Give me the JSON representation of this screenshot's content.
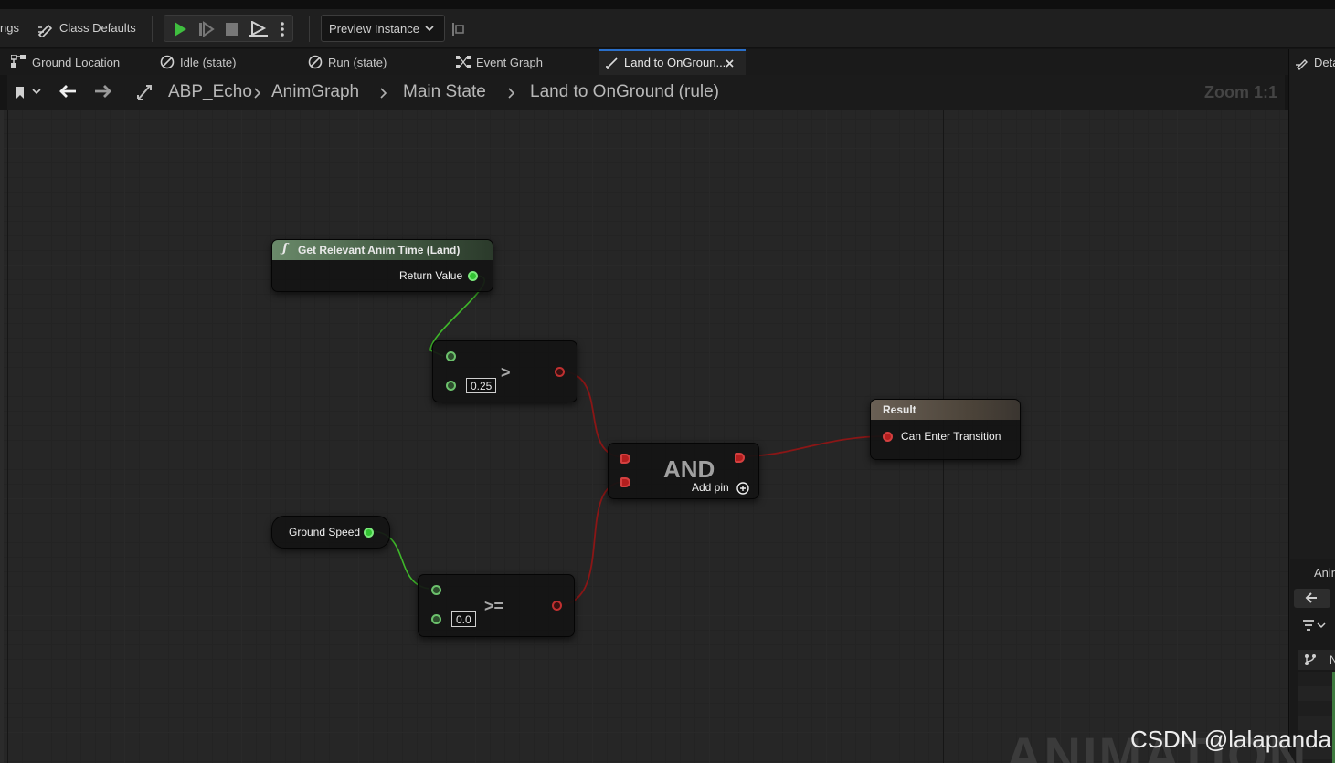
{
  "toolbar": {
    "cut_left": "ngs",
    "class_defaults": "Class Defaults",
    "preview_instance": "Preview Instance"
  },
  "tabs": [
    {
      "label": "Ground Location",
      "icon": "graph-icon"
    },
    {
      "label": "Idle (state)",
      "icon": "state-icon"
    },
    {
      "label": "Run (state)",
      "icon": "state-icon"
    },
    {
      "label": "Event Graph",
      "icon": "event-graph-icon"
    },
    {
      "label": "Land to OnGroun...",
      "icon": "transition-icon",
      "active": true
    }
  ],
  "right_panel": {
    "details_label": "Deta",
    "anim_label": "Anin",
    "col_label": "N"
  },
  "breadcrumb": {
    "items": [
      "ABP_Echo",
      "AnimGraph",
      "Main State",
      "Land to OnGround (rule)"
    ],
    "zoom": "Zoom 1:1"
  },
  "nodes": {
    "get_time": {
      "title": "Get Relevant Anim Time (Land)",
      "output": "Return Value"
    },
    "greater": {
      "op": ">",
      "value": "0.25"
    },
    "and": {
      "title": "AND",
      "add_pin": "Add pin"
    },
    "result": {
      "title": "Result",
      "input": "Can Enter Transition"
    },
    "ground_speed": {
      "label": "Ground Speed"
    },
    "gte": {
      "op": ">=",
      "value": "0.0"
    }
  },
  "colors": {
    "float_wire": "#3fb82a",
    "bool_wire": "#8a1616",
    "active_tab": "#2a6fc9",
    "play": "#3fbe3f"
  },
  "watermark": "CSDN @lalapanda",
  "background_text": "ANIMATION"
}
